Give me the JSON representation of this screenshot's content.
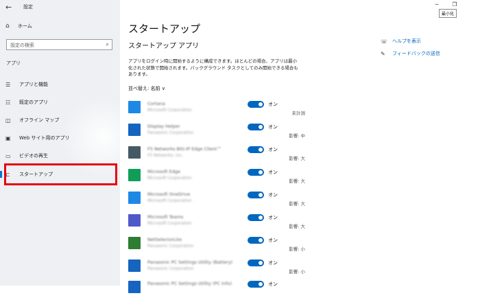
{
  "window": {
    "title": "設定",
    "back_icon": "←",
    "minimize_icon": "─",
    "restore_icon": "❐",
    "minimize_tooltip": "最小化"
  },
  "sidebar": {
    "home": {
      "label": "ホーム",
      "icon": "⌂"
    },
    "search": {
      "placeholder": "設定の検索",
      "icon": "⌕"
    },
    "section_label": "アプリ",
    "items": [
      {
        "id": "apps-features",
        "label": "アプリと機能",
        "icon": "☰"
      },
      {
        "id": "default-apps",
        "label": "既定のアプリ",
        "icon": "☷"
      },
      {
        "id": "offline-maps",
        "label": "オフライン マップ",
        "icon": "◫"
      },
      {
        "id": "web-apps",
        "label": "Web サイト用のアプリ",
        "icon": "▣"
      },
      {
        "id": "video-playback",
        "label": "ビデオの再生",
        "icon": "▭"
      },
      {
        "id": "startup",
        "label": "スタートアップ",
        "icon": "⊏"
      }
    ],
    "active_item": "startup"
  },
  "main": {
    "page_title": "スタートアップ",
    "subtitle": "スタートアップ アプリ",
    "description": "アプリをログイン時に開始するように構成できます。ほとんどの場合、アプリは最小化された状態で開始されます。バックグラウンド タスクとしてのみ開始できる場合もあります。",
    "sort_label": "並べ替え:",
    "sort_value": "名前",
    "sort_chevron": "∨",
    "apps": [
      {
        "name": "Cortana",
        "publisher": "Microsoft Corporation",
        "state": "オン",
        "impact": "未計測",
        "icon_color": "#1e88e5"
      },
      {
        "name": "Display Helper",
        "publisher": "Panasonic Corporation",
        "state": "オン",
        "impact": "影響: 中",
        "icon_color": "#1565c0"
      },
      {
        "name": "F5 Networks BIG-IP Edge Client™",
        "publisher": "F5 Networks, Inc.",
        "state": "オン",
        "impact": "影響: 大",
        "icon_color": "#455a64"
      },
      {
        "name": "Microsoft Edge",
        "publisher": "Microsoft Corporation",
        "state": "オン",
        "impact": "影響: 大",
        "icon_color": "#0f9d58"
      },
      {
        "name": "Microsoft OneDrive",
        "publisher": "Microsoft Corporation",
        "state": "オン",
        "impact": "影響: 大",
        "icon_color": "#1e88e5"
      },
      {
        "name": "Microsoft Teams",
        "publisher": "Microsoft Corporation",
        "state": "オン",
        "impact": "影響: 大",
        "icon_color": "#5059c9"
      },
      {
        "name": "NetSelectorLite",
        "publisher": "Panasonic Corporation",
        "state": "オン",
        "impact": "影響: 小",
        "icon_color": "#2e7d32"
      },
      {
        "name": "Panasonic PC Settings Utility (Battery)",
        "publisher": "Panasonic Corporation",
        "state": "オン",
        "impact": "影響: 小",
        "icon_color": "#1565c0"
      },
      {
        "name": "Panasonic PC Settings Utility (PC Info)",
        "publisher": "Panasonic Corporation",
        "state": "オン",
        "impact": "",
        "icon_color": "#1565c0"
      }
    ]
  },
  "side_links": [
    {
      "label": "ヘルプを表示",
      "icon": "☏"
    },
    {
      "label": "フィードバックの送信",
      "icon": "✎"
    }
  ],
  "highlight_color": "#e60012",
  "accent_color": "#0067c0"
}
